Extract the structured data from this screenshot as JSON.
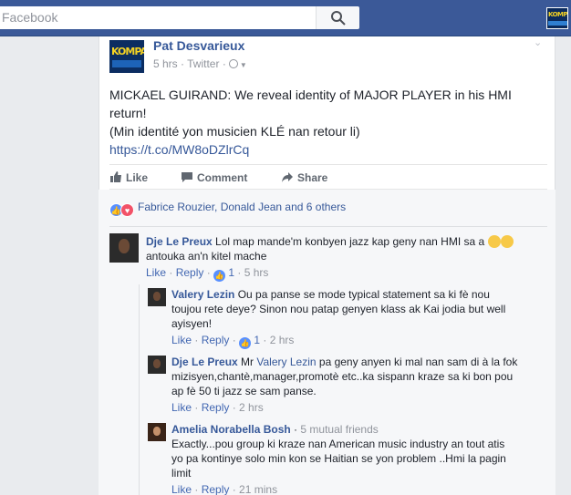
{
  "search": {
    "placeholder": "Facebook"
  },
  "post": {
    "author": "Pat Desvarieux",
    "time": "5 hrs",
    "via": "Twitter",
    "line1": "MICKAEL GUIRAND: We reveal identity of MAJOR PLAYER in his HMI",
    "line2": "return!",
    "line3": "(Min identité yon musicien KLÉ nan retour li)",
    "link": "https://t.co/MW8oDZlrCq",
    "logo_text": "KOMPA"
  },
  "actions": {
    "like": "Like",
    "comment": "Comment",
    "share": "Share"
  },
  "reactions": {
    "names": "Fabrice Rouzier, Donald Jean and 6 others"
  },
  "comments": [
    {
      "name": "Dje Le Preux",
      "text1": "Lol map mande'm konbyen jazz kap geny nan HMI sa a",
      "text2": "antouka an'n kitel mache",
      "like": "Like",
      "reply": "Reply",
      "likes": "1",
      "time": "5 hrs"
    }
  ],
  "replies": [
    {
      "name": "Valery Lezin",
      "text1": "Ou pa panse se mode typical statement sa ki fè nou",
      "text2": "toujou rete deye? Sinon nou patap genyen klass ak Kai jodia but well",
      "text3": "ayisyen!",
      "like": "Like",
      "reply": "Reply",
      "likes": "1",
      "time": "2 hrs"
    },
    {
      "name": "Dje Le Preux",
      "mention_prefix": "Mr",
      "mention": "Valery Lezin",
      "text1": "pa geny anyen ki mal nan sam di à la fok",
      "text2": "mizisyen,chantè,manager,promotè etc..ka sispann kraze sa ki bon pou",
      "text3": "ap fè 50 ti jazz se sam panse.",
      "like": "Like",
      "reply": "Reply",
      "time": "2 hrs"
    },
    {
      "name": "Amelia Norabella Bosh",
      "mutual": "5 mutual friends",
      "text1": "Exactly...pou group ki kraze nan American music industry an tout atis",
      "text2": "yo pa kontinye solo min kon se Haitian se yon problem ..Hmi la pagin",
      "text3": "limit",
      "like": "Like",
      "reply": "Reply",
      "time": "21 mins"
    }
  ],
  "colors": {
    "header": "#3b5998",
    "link": "#365899",
    "like_blue": "#5890ff",
    "love_red": "#f25268"
  }
}
